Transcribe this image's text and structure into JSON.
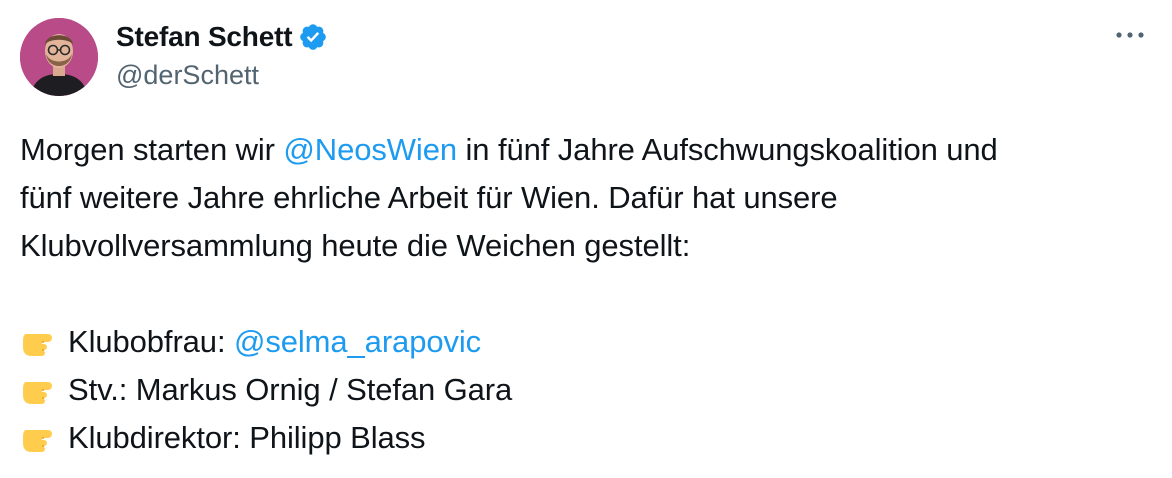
{
  "author": {
    "display_name": "Stefan Schett",
    "handle": "@derSchett"
  },
  "icons": {
    "verified": "verified-badge-icon",
    "more": "more-options-icon",
    "pointer": "backhand-index-pointing-right-emoji"
  },
  "colors": {
    "mention": "#1d9bf0",
    "verified": "#1d9bf0",
    "text": "#0f1419",
    "secondary": "#536471"
  },
  "tweet": {
    "line1_pre": "Morgen starten wir ",
    "line1_mention": "@NeosWien",
    "line1_post": " in fünf Jahre Aufschwungskoalition und",
    "line2": "fünf weitere Jahre ehrliche Arbeit für Wien. Dafür hat unsere",
    "line3": "Klubvollversammlung heute die Weichen gestellt:",
    "item1_label": "Klubobfrau: ",
    "item1_mention": "@selma_arapovic",
    "item2": "Stv.: Markus Ornig / Stefan Gara",
    "item3": "Klubdirektor: Philipp Blass"
  }
}
